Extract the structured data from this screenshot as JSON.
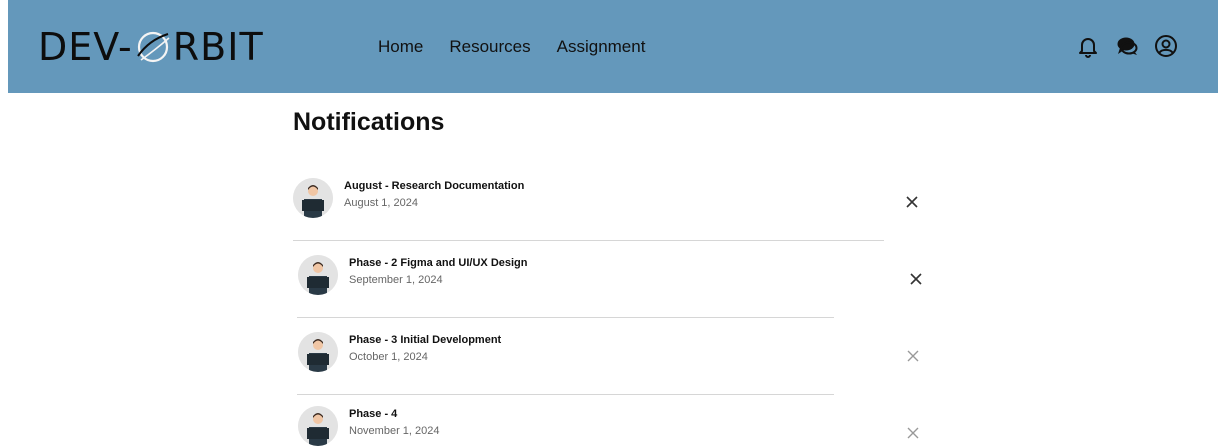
{
  "header": {
    "logo_text": "DEV-ORBIT",
    "logo_left": "DEV-",
    "logo_right": "RBIT",
    "nav": [
      {
        "label": "Home"
      },
      {
        "label": "Resources"
      },
      {
        "label": "Assignment"
      }
    ],
    "icons": [
      "bell-icon",
      "chat-icon",
      "user-profile-icon"
    ]
  },
  "page": {
    "title": "Notifications"
  },
  "notifications": [
    {
      "title": "August - Research Documentation",
      "date": "August 1, 2024"
    },
    {
      "title": "Phase - 2 Figma and UI/UX Design",
      "date": "September 1, 2024"
    },
    {
      "title": "Phase - 3 Initial Development",
      "date": "October 1, 2024"
    },
    {
      "title": "Phase - 4",
      "date": "November 1, 2024"
    }
  ],
  "colors": {
    "navbar": "#6498bb",
    "text": "#111111",
    "date_text": "#666666",
    "divider": "#d6d6d6"
  }
}
